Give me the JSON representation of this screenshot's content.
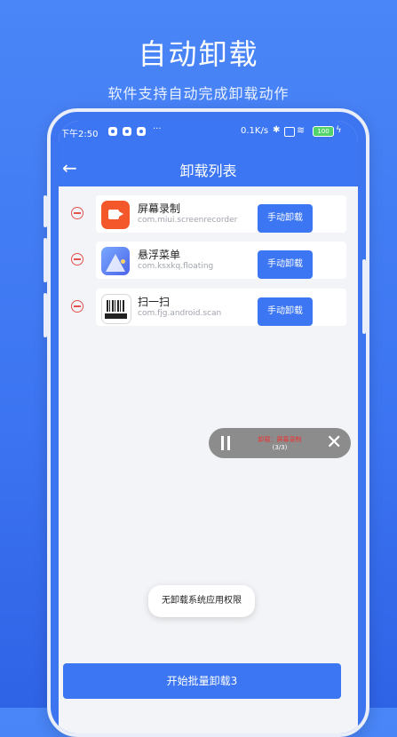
{
  "hero": {
    "title": "自动卸载",
    "subtitle": "软件支持自动完成卸载动作"
  },
  "status_bar": {
    "time": "下午2:50",
    "dots": "···",
    "net_speed": "0.1K/s",
    "battery": "100"
  },
  "header": {
    "title": "卸载列表",
    "back_icon": "arrow-left-icon"
  },
  "apps": [
    {
      "name": "屏幕录制",
      "package": "com.miui.screenrecorder",
      "button": "手动卸载",
      "icon": "screen-recorder-icon"
    },
    {
      "name": "悬浮菜单",
      "package": "com.ksxkq.floating",
      "button": "手动卸载",
      "icon": "floating-menu-icon"
    },
    {
      "name": "扫一扫",
      "package": "com.fjg.android.scan",
      "button": "手动卸载",
      "icon": "barcode-scan-icon"
    }
  ],
  "floater": {
    "status": "卸载：屏幕录制",
    "progress": "(3/3)"
  },
  "toast": {
    "text": "无卸载系统应用权限"
  },
  "batch_button": {
    "label": "开始批量卸载3"
  },
  "colors": {
    "primary": "#3c76f2",
    "danger": "#e3524f"
  }
}
